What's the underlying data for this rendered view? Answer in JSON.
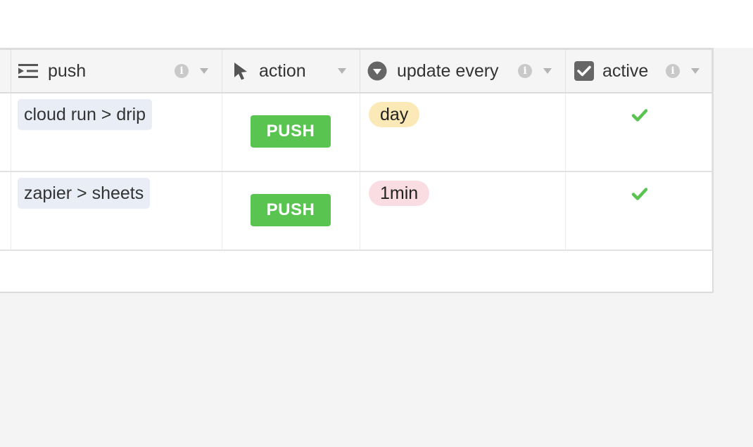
{
  "columns": [
    {
      "key": "push",
      "label": "push",
      "icon": "long-text-icon"
    },
    {
      "key": "action",
      "label": "action",
      "icon": "cursor-icon"
    },
    {
      "key": "update_every",
      "label": "update every",
      "icon": "single-select-icon"
    },
    {
      "key": "active",
      "label": "active",
      "icon": "checkbox-icon"
    }
  ],
  "rows": [
    {
      "push": "cloud run > drip",
      "action": "PUSH",
      "update_every": "day",
      "update_color": "#fbe9b7",
      "active": true
    },
    {
      "push": "zapier > sheets",
      "action": "PUSH",
      "update_every": "1min",
      "update_color": "#fadde3",
      "active": true
    }
  ],
  "colors": {
    "button_green": "#5ac451",
    "check_green": "#5ac451",
    "chip_blue": "#e9edf6"
  }
}
